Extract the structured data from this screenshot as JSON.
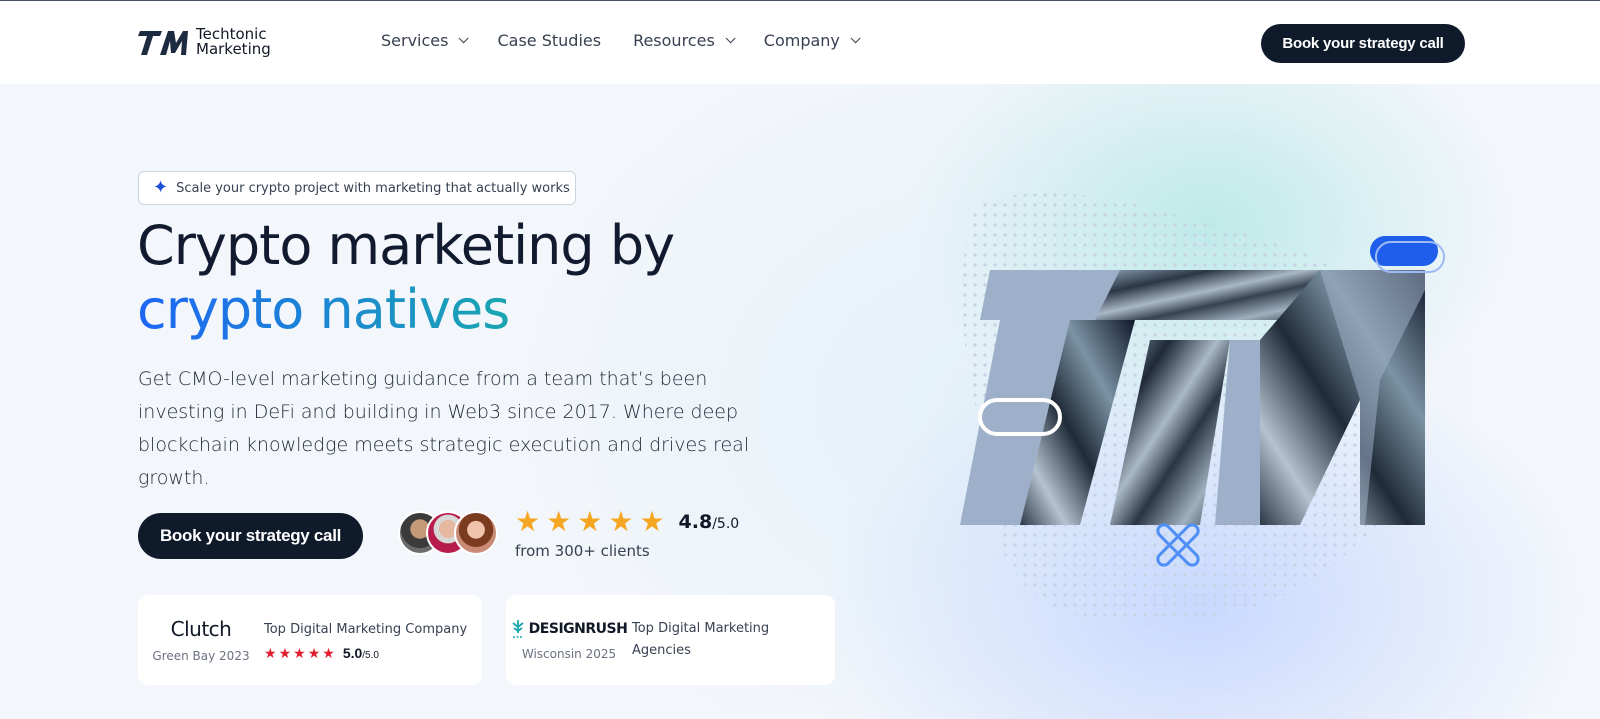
{
  "header": {
    "logo_line1": "Techtonic",
    "logo_line2": "Marketing",
    "nav": [
      {
        "label": "Services",
        "has_dropdown": true
      },
      {
        "label": "Case Studies",
        "has_dropdown": false
      },
      {
        "label": "Resources",
        "has_dropdown": true
      },
      {
        "label": "Company",
        "has_dropdown": true
      }
    ],
    "cta_label": "Book your strategy call"
  },
  "hero": {
    "pill_text": "Scale your crypto project with marketing that actually works",
    "title_line1": "Crypto marketing by",
    "title_line2": "crypto natives",
    "description": "Get CMO-level marketing guidance from a team that’s been investing in DeFi and building in Web3 since 2017. Where deep blockchain knowledge meets strategic execution and drives real growth.",
    "cta_label": "Book your strategy call",
    "rating": {
      "stars": 5,
      "score": "4.8",
      "max": "/5.0",
      "subtitle": "from 300+ clients"
    }
  },
  "awards": [
    {
      "brand": "Clutch",
      "location": "Green Bay 2023",
      "title": "Top Digital Marketing Company",
      "stars": 5,
      "score": "5.0",
      "max": "/5.0"
    },
    {
      "brand": "DESIGNRUSH",
      "location": "Wisconsin 2025",
      "title": "Top Digital Marketing Agencies"
    }
  ],
  "colors": {
    "dark": "#0f1a2b",
    "accent_blue": "#1e66f5",
    "accent_teal": "#1aa6b0",
    "star": "#f5a623",
    "clutch_star": "#e11d2e"
  },
  "icons": [
    "chevron-down-icon",
    "sparkle-icon",
    "star-icon"
  ]
}
